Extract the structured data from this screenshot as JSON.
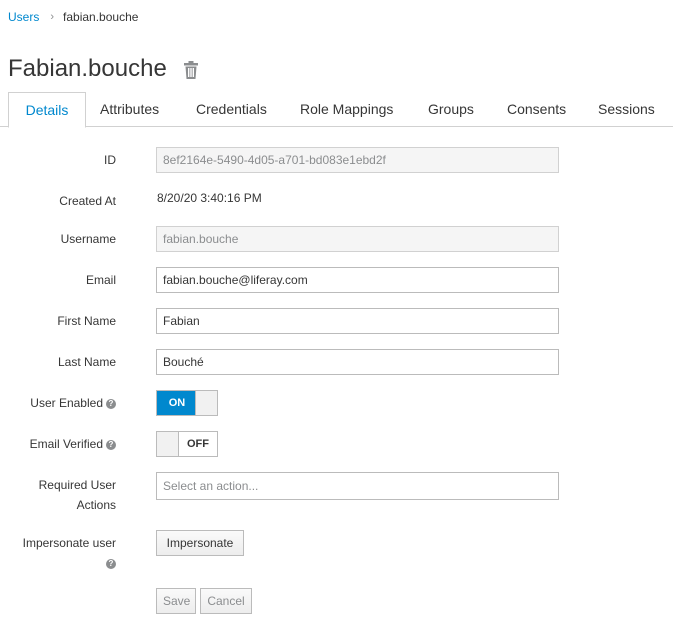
{
  "breadcrumb": {
    "parent": "Users",
    "separator": "›",
    "current": "fabian.bouche"
  },
  "page": {
    "title": "Fabian.bouche"
  },
  "tabs": [
    {
      "label": "Details",
      "active": true
    },
    {
      "label": "Attributes"
    },
    {
      "label": "Credentials"
    },
    {
      "label": "Role Mappings"
    },
    {
      "label": "Groups"
    },
    {
      "label": "Consents"
    },
    {
      "label": "Sessions"
    }
  ],
  "form": {
    "id": {
      "label": "ID",
      "value": "8ef2164e-5490-4d05-a701-bd083e1ebd2f"
    },
    "created_at": {
      "label": "Created At",
      "value": "8/20/20 3:40:16 PM"
    },
    "username": {
      "label": "Username",
      "value": "fabian.bouche"
    },
    "email": {
      "label": "Email",
      "value": "fabian.bouche@liferay.com"
    },
    "first_name": {
      "label": "First Name",
      "value": "Fabian"
    },
    "last_name": {
      "label": "Last Name",
      "value": "Bouché"
    },
    "user_enabled": {
      "label": "User Enabled",
      "state": "ON"
    },
    "email_verified": {
      "label": "Email Verified",
      "state": "OFF"
    },
    "required_actions": {
      "label_line1": "Required User",
      "label_line2": "Actions",
      "placeholder": "Select an action..."
    },
    "impersonate": {
      "label": "Impersonate user",
      "button": "Impersonate"
    }
  },
  "actions": {
    "save": "Save",
    "cancel": "Cancel"
  },
  "colors": {
    "accent": "#0088ce",
    "text": "#363636",
    "border": "#d1d1d1"
  },
  "icons": {
    "delete": "trash-icon",
    "help": "question-circle-icon"
  }
}
